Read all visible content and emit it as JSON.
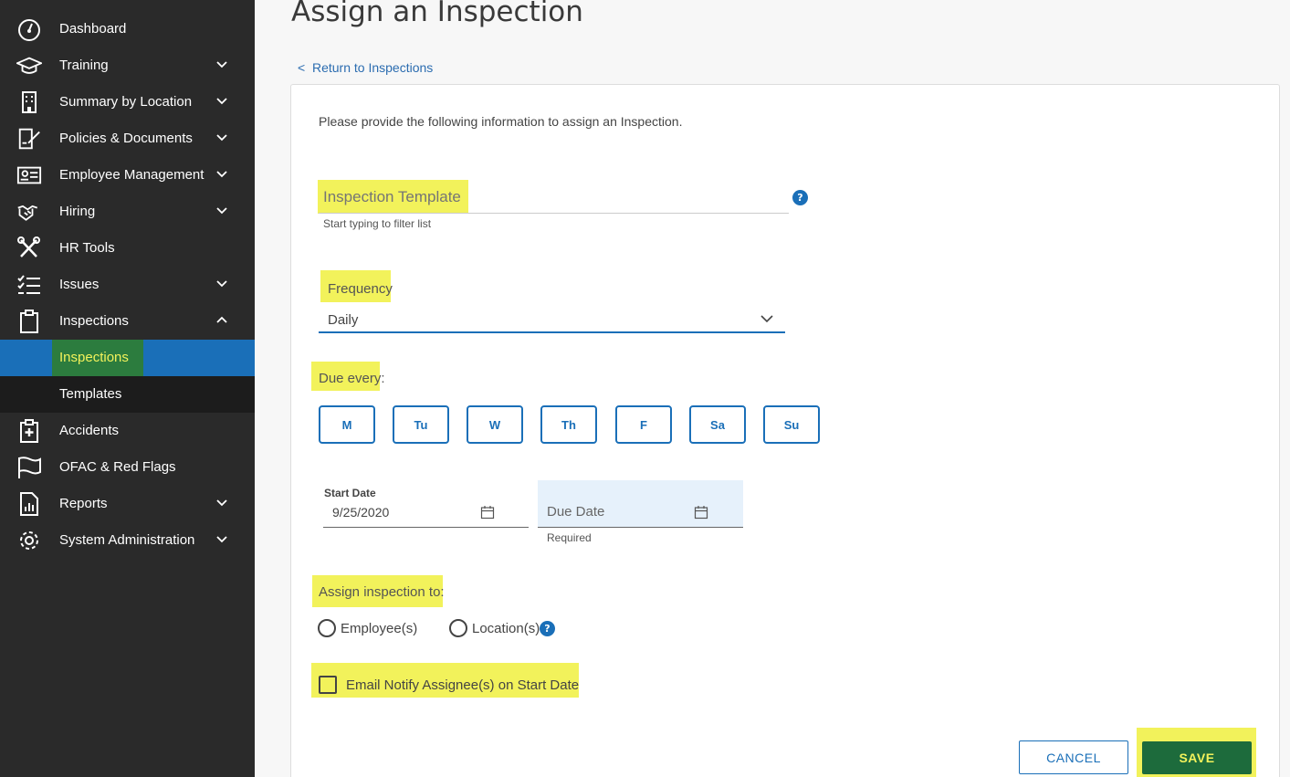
{
  "sidebar": {
    "items": [
      {
        "label": "Dashboard",
        "icon": "dashboard-icon",
        "has_chevron": false
      },
      {
        "label": "Training",
        "icon": "graduation-cap-icon",
        "has_chevron": true
      },
      {
        "label": "Summary by Location",
        "icon": "building-icon",
        "has_chevron": true
      },
      {
        "label": "Policies & Documents",
        "icon": "document-pen-icon",
        "has_chevron": true
      },
      {
        "label": "Employee Management",
        "icon": "id-card-icon",
        "has_chevron": true
      },
      {
        "label": "Hiring",
        "icon": "handshake-icon",
        "has_chevron": true
      },
      {
        "label": "HR Tools",
        "icon": "tools-icon",
        "has_chevron": false
      },
      {
        "label": "Issues",
        "icon": "checklist-icon",
        "has_chevron": true
      },
      {
        "label": "Inspections",
        "icon": "clipboard-icon",
        "has_chevron": true,
        "expanded": true
      },
      {
        "label": "Accidents",
        "icon": "medical-clipboard-icon",
        "has_chevron": false
      },
      {
        "label": "OFAC & Red Flags",
        "icon": "flag-icon",
        "has_chevron": false
      },
      {
        "label": "Reports",
        "icon": "report-icon",
        "has_chevron": true
      },
      {
        "label": "System Administration",
        "icon": "gear-icon",
        "has_chevron": true
      }
    ],
    "sub_items": [
      {
        "label": "Inspections",
        "active": true
      },
      {
        "label": "Templates",
        "active": false
      }
    ]
  },
  "page": {
    "title": "Assign an Inspection",
    "return_link": "Return to Inspections",
    "intro": "Please provide the following information to assign an Inspection."
  },
  "form": {
    "template": {
      "placeholder": "Inspection Template",
      "hint": "Start typing to filter list",
      "help": "?"
    },
    "frequency": {
      "label": "Frequency",
      "value": "Daily"
    },
    "due_every": {
      "label": "Due every:",
      "days": [
        "M",
        "Tu",
        "W",
        "Th",
        "F",
        "Sa",
        "Su"
      ]
    },
    "start_date": {
      "label": "Start Date",
      "value": "9/25/2020"
    },
    "due_date": {
      "placeholder": "Due Date",
      "hint": "Required"
    },
    "assign_to": {
      "label": "Assign inspection to:",
      "options": [
        "Employee(s)",
        "Location(s)"
      ],
      "help": "?"
    },
    "email_notify": {
      "label": "Email Notify Assignee(s) on Start Date",
      "checked": false
    }
  },
  "buttons": {
    "cancel": "CANCEL",
    "save": "SAVE"
  },
  "colors": {
    "sidebar_bg": "#2a2a2a",
    "accent_blue": "#1a6fb8",
    "highlight": "#f2f25b",
    "save_green": "#1d6b3c"
  }
}
